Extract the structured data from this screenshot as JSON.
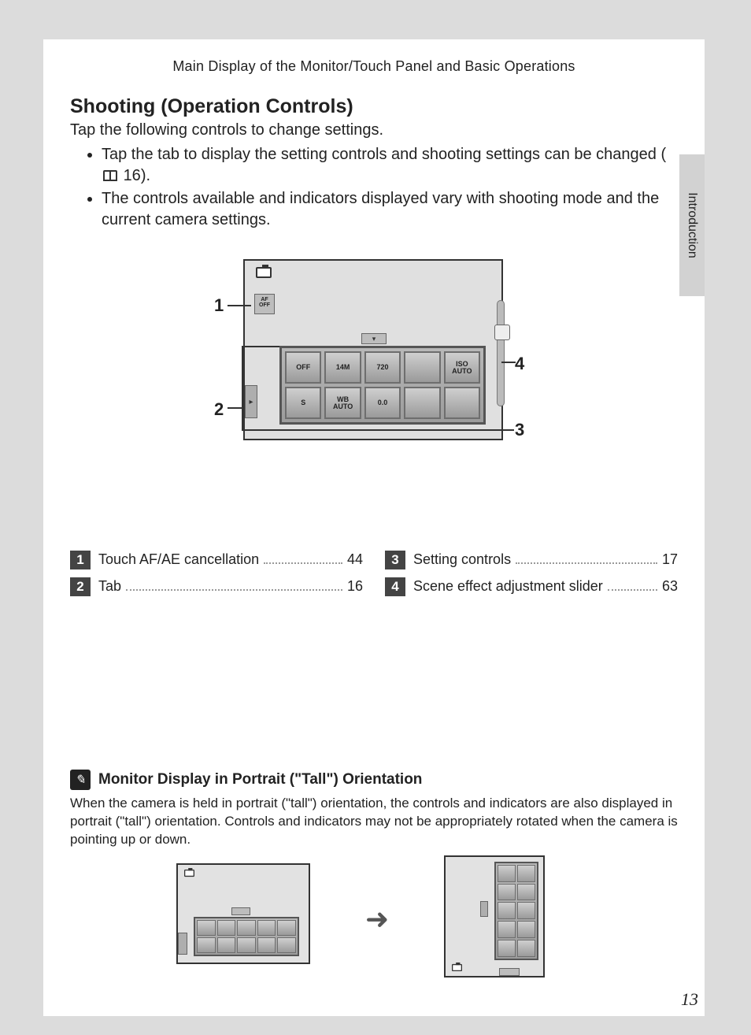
{
  "header": "Main Display of the Monitor/Touch Panel and Basic Operations",
  "side_tab": "Introduction",
  "title": "Shooting (Operation Controls)",
  "lead": "Tap the following controls to change settings.",
  "bullets": [
    {
      "pre": "Tap the tab to display the setting controls and shooting settings can be changed (",
      "ref": "16",
      "post": ")."
    },
    {
      "text": "The controls available and indicators displayed vary with shooting mode and the current camera settings."
    }
  ],
  "diagram": {
    "af_off": "AF\nOFF",
    "cells_row1": [
      "OFF",
      "14M",
      "720",
      "",
      "ISO\nAUTO"
    ],
    "cells_row2": [
      "S",
      "WB\nAUTO",
      "0.0",
      "",
      ""
    ]
  },
  "callouts": {
    "n1": "1",
    "n2": "2",
    "n3": "3",
    "n4": "4"
  },
  "legend_left": [
    {
      "num": "1",
      "label": "Touch AF/AE cancellation",
      "page": "44"
    },
    {
      "num": "2",
      "label": "Tab",
      "page": "16"
    }
  ],
  "legend_right": [
    {
      "num": "3",
      "label": "Setting controls",
      "page": "17"
    },
    {
      "num": "4",
      "label": "Scene effect adjustment slider",
      "page": "63"
    }
  ],
  "note": {
    "title": "Monitor Display in Portrait (\"Tall\") Orientation",
    "body": "When the camera is held in portrait (\"tall\") orientation, the controls and indicators are also displayed in portrait (\"tall\") orientation. Controls and indicators may not be appropriately rotated when the camera is pointing up or down."
  },
  "page_number": "13"
}
